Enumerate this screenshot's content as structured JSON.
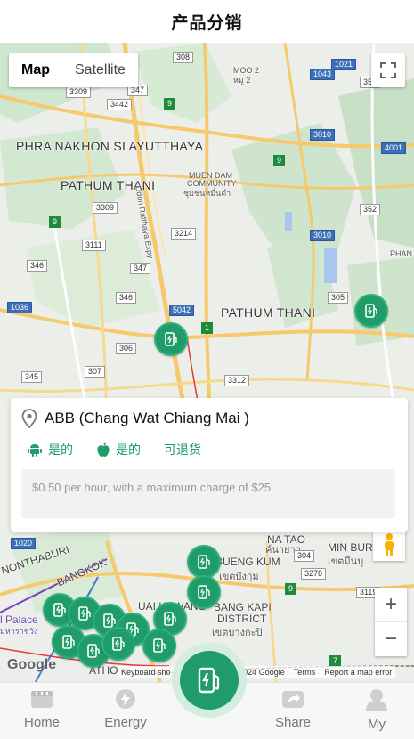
{
  "header": {
    "title": "产品分销"
  },
  "map": {
    "type_options": [
      "Map",
      "Satellite"
    ],
    "selected_type": "Map",
    "labels": {
      "moo2": "MOO 2",
      "moo2_thai": "หมู่ 2",
      "phra_nakhon": "PHRA NAKHON SI AYUTTHAYA",
      "pathum_thani_w": "PATHUM THANI",
      "pathum_thani_e": "PATHUM THANI",
      "muen_dam_1": "MUEN DAM",
      "muen_dam_2": "COMMUNITY",
      "muen_dam_3": "ชุมชนหมื่นดำ",
      "udon_exwy": "Udon Ratthaya Expy",
      "phan": "PHAN",
      "nonthaburi": "NONTHABURI",
      "bangkok": "BANGKOK",
      "bueng_kum": "BUENG KUM",
      "bueng_kum_thai": "เขตบึงกุ่ม",
      "bang_kapi_1": "BANG KAPI",
      "bang_kapi_2": "DISTRICT",
      "bang_kapi_thai": "เขตบางกะปิ",
      "min_buri": "MIN BUR",
      "min_buri_thai": "เขตมีนบุ",
      "na_tao": "NA TAO",
      "na_tao_thai": "ค์นายาว",
      "huai_khwang": "UAI KHWANG",
      "palace": "l Palace",
      "palace_thai": "มหาราชวัง",
      "nathon": "ATHO"
    },
    "shields": [
      "308",
      "1021",
      "1043",
      "352",
      "3309",
      "347",
      "3442",
      "9",
      "3010",
      "4001",
      "9",
      "352",
      "3309",
      "3214",
      "3010",
      "9",
      "3111",
      "346",
      "347",
      "1036",
      "346",
      "5042",
      "1",
      "305",
      "306",
      "307",
      "345",
      "3312",
      "1020",
      "304",
      "3278",
      "9",
      "3119",
      "7"
    ],
    "attribution": {
      "google": "Google",
      "keyboard": "Keyboard sho",
      "data": "©2024 Google",
      "terms": "Terms",
      "report": "Report a map error"
    },
    "zoom": {
      "in": "+",
      "out": "−"
    }
  },
  "station_card": {
    "name": "ABB (Chang Wat Chiang Mai )",
    "android_label": "是的",
    "apple_label": "是的",
    "refund_label": "可退货",
    "description": "$0.50 per hour, with a maximum charge of $25."
  },
  "tabbar": {
    "items": [
      {
        "label": "Home",
        "icon": "home-icon"
      },
      {
        "label": "Energy",
        "icon": "energy-icon"
      },
      {
        "label": "Share",
        "icon": "share-icon"
      },
      {
        "label": "My",
        "icon": "user-icon"
      }
    ],
    "center_icon": "charging-station-icon"
  },
  "colors": {
    "accent": "#1f9c6a",
    "accent_light": "#d5ece2"
  }
}
